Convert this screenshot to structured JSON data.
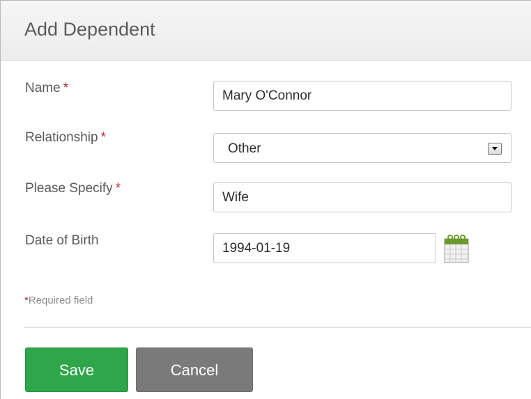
{
  "dialog": {
    "title": "Add Dependent"
  },
  "form": {
    "name": {
      "label": "Name",
      "required_mark": "*",
      "value": "Mary O'Connor"
    },
    "relationship": {
      "label": "Relationship",
      "required_mark": "*",
      "selected": "Other"
    },
    "specify": {
      "label": "Please Specify",
      "required_mark": "*",
      "value": "Wife"
    },
    "dob": {
      "label": "Date of Birth",
      "value": "1994-01-19",
      "icon": "calendar-icon"
    },
    "required_note": {
      "star": "*",
      "text": "Required field"
    }
  },
  "actions": {
    "save_label": "Save",
    "cancel_label": "Cancel"
  },
  "colors": {
    "save": "#2fa64a",
    "cancel": "#7a7a7a",
    "required_star": "#b52a2a",
    "calendar_top": "#6b9a2a"
  }
}
